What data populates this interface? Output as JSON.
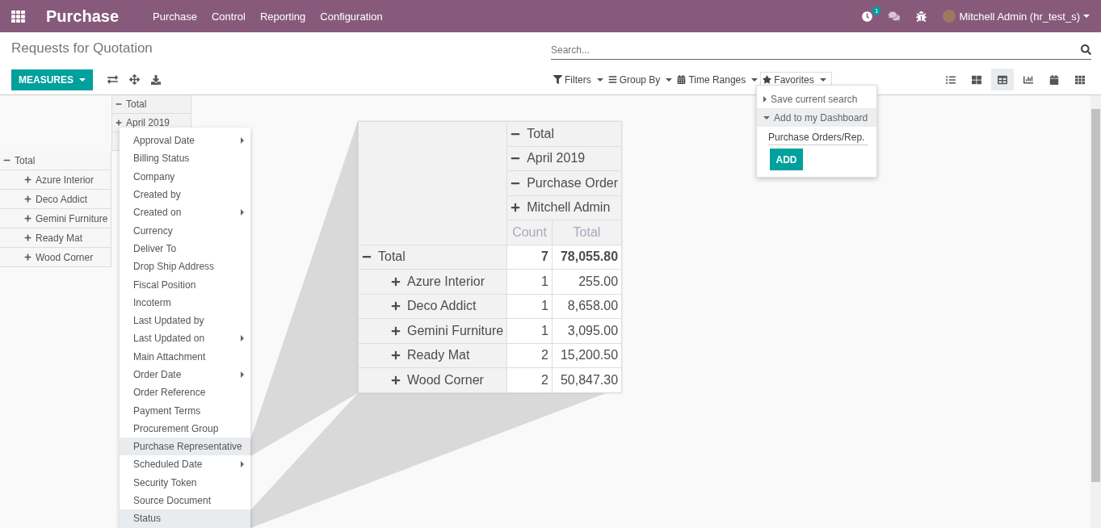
{
  "navbar": {
    "app_name": "Purchase",
    "menu": [
      "Purchase",
      "Control",
      "Reporting",
      "Configuration"
    ],
    "activity_count": "1",
    "user": "Mitchell Admin (hr_test_s)"
  },
  "control_panel": {
    "title": "Requests for Quotation",
    "search": {
      "placeholder": "Search..."
    },
    "measures_button": "MEASURES",
    "search_options": [
      {
        "kind": "filter",
        "label": "Filters",
        "selected": false
      },
      {
        "kind": "groupby",
        "label": "Group By",
        "selected": false
      },
      {
        "kind": "timerange",
        "label": "Time Ranges",
        "selected": false
      },
      {
        "kind": "favorites",
        "label": "Favorites",
        "selected": true
      }
    ],
    "views": [
      {
        "kind": "list",
        "selected": false
      },
      {
        "kind": "kanban",
        "selected": false
      },
      {
        "kind": "pivot",
        "selected": true
      },
      {
        "kind": "graph",
        "selected": false
      },
      {
        "kind": "calendar",
        "selected": false
      },
      {
        "kind": "grid",
        "selected": false
      }
    ]
  },
  "favorites_menu": {
    "items": [
      {
        "label": "Save current search",
        "expanded": false
      },
      {
        "label": "Add to my Dashboard",
        "expanded": true
      }
    ],
    "dashboard_name": "Purchase Orders/Rep.",
    "add_button": "ADD"
  },
  "pivot": {
    "column_headers": [
      {
        "label": "Total",
        "expanded": true
      },
      {
        "label": "April 2019",
        "expanded": false
      }
    ],
    "rows": [
      {
        "label": "Total",
        "expanded": true,
        "children": [
          {
            "label": "Azure Interior",
            "expanded": false
          },
          {
            "label": "Deco Addict",
            "expanded": false
          },
          {
            "label": "Gemini Furniture",
            "expanded": false
          },
          {
            "label": "Ready Mat",
            "expanded": false
          },
          {
            "label": "Wood Corner",
            "expanded": false
          }
        ]
      }
    ]
  },
  "groupby_menu": {
    "items": [
      {
        "label": "Approval Date",
        "submenu": true,
        "selected": false
      },
      {
        "label": "Billing Status",
        "submenu": false,
        "selected": false
      },
      {
        "label": "Company",
        "submenu": false,
        "selected": false
      },
      {
        "label": "Created by",
        "submenu": false,
        "selected": false
      },
      {
        "label": "Created on",
        "submenu": true,
        "selected": false
      },
      {
        "label": "Currency",
        "submenu": false,
        "selected": false
      },
      {
        "label": "Deliver To",
        "submenu": false,
        "selected": false
      },
      {
        "label": "Drop Ship Address",
        "submenu": false,
        "selected": false
      },
      {
        "label": "Fiscal Position",
        "submenu": false,
        "selected": false
      },
      {
        "label": "Incoterm",
        "submenu": false,
        "selected": false
      },
      {
        "label": "Last Updated by",
        "submenu": false,
        "selected": false
      },
      {
        "label": "Last Updated on",
        "submenu": true,
        "selected": false
      },
      {
        "label": "Main Attachment",
        "submenu": false,
        "selected": false
      },
      {
        "label": "Order Date",
        "submenu": true,
        "selected": false
      },
      {
        "label": "Order Reference",
        "submenu": false,
        "selected": false
      },
      {
        "label": "Payment Terms",
        "submenu": false,
        "selected": false
      },
      {
        "label": "Procurement Group",
        "submenu": false,
        "selected": false
      },
      {
        "label": "Purchase Representative",
        "submenu": false,
        "selected": true
      },
      {
        "label": "Scheduled Date",
        "submenu": true,
        "selected": false
      },
      {
        "label": "Security Token",
        "submenu": false,
        "selected": false
      },
      {
        "label": "Source Document",
        "submenu": false,
        "selected": false
      },
      {
        "label": "Status",
        "submenu": false,
        "selected": true
      }
    ]
  },
  "inset": {
    "column_headers": [
      {
        "label": "Total",
        "expanded": true
      },
      {
        "label": "April 2019",
        "expanded": true
      },
      {
        "label": "Purchase Order",
        "expanded": true
      },
      {
        "label": "Mitchell Admin",
        "expanded": false
      }
    ],
    "measures": [
      "Count",
      "Total"
    ],
    "rows": [
      {
        "label": "Total",
        "expanded": true,
        "count": "7",
        "total": "78,055.80",
        "children": [
          {
            "label": "Azure Interior",
            "expanded": false,
            "count": "1",
            "total": "255.00"
          },
          {
            "label": "Deco Addict",
            "expanded": false,
            "count": "1",
            "total": "8,658.00"
          },
          {
            "label": "Gemini Furniture",
            "expanded": false,
            "count": "1",
            "total": "3,095.00"
          },
          {
            "label": "Ready Mat",
            "expanded": false,
            "count": "2",
            "total": "15,200.50"
          },
          {
            "label": "Wood Corner",
            "expanded": false,
            "count": "2",
            "total": "50,847.30"
          }
        ]
      }
    ]
  }
}
